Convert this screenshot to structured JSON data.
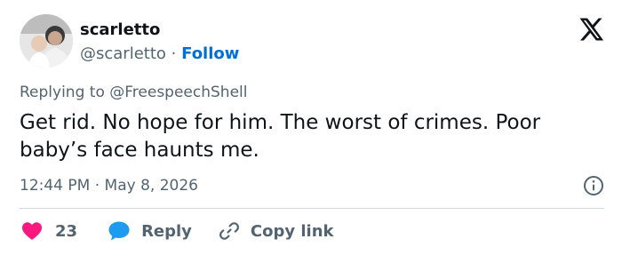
{
  "header": {
    "display_name": "scarletto",
    "handle": "@scarletto",
    "separator": "·",
    "follow_label": "Follow"
  },
  "tweet": {
    "replying_prefix": "Replying to",
    "replying_to": "@FreespeechShell",
    "text": "Get rid. No hope for him. The worst of crimes. Poor baby’s face haunts me.",
    "time": "12:44 PM",
    "date_separator": "·",
    "date": "May 8, 2026"
  },
  "actions": {
    "like_count": "23",
    "reply_label": "Reply",
    "copy_link_label": "Copy link"
  },
  "colors": {
    "like": "#f91880",
    "reply": "#1d9bf0",
    "follow": "#006fd6",
    "muted": "#536471"
  },
  "icons": {
    "logo": "x-logo-icon",
    "info": "info-icon",
    "like": "heart-icon",
    "reply": "speech-bubble-icon",
    "copy": "link-icon"
  }
}
